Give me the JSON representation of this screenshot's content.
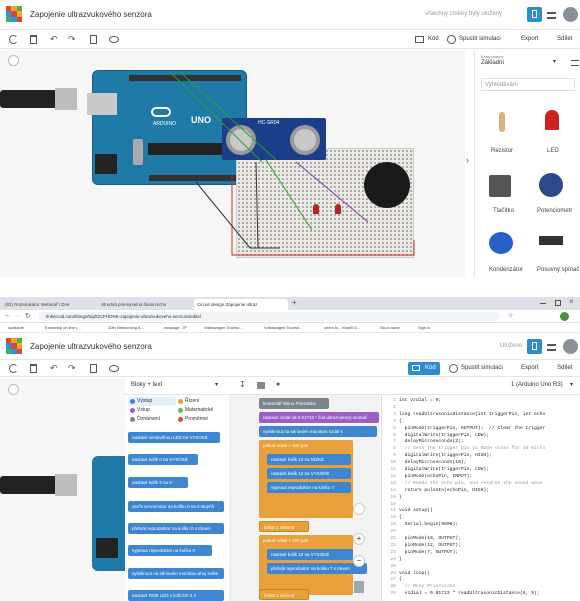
{
  "top": {
    "title": "Zapojenie ultrazvukového senzora",
    "saved": "Všechny změny byly uloženy",
    "toolbar": {
      "code": "Kód",
      "simulate": "Spustit simulaci",
      "export": "Export",
      "share": "Sdílet"
    },
    "panel": {
      "components_label": "Komponenty",
      "components_value": "Základní",
      "search_placeholder": "Vyhledávání",
      "items": [
        "Rezistor",
        "LED",
        "Tlačítko",
        "Potenciometr",
        "Kondenzátor",
        "Posuvný spínač"
      ]
    },
    "arduino": {
      "brand": "ARDUINO",
      "model": "UNO"
    },
    "sensor": {
      "label": "HC-SR04"
    }
  },
  "browser": {
    "tabs": [
      "(83) Rozetnikátor Webinář / Dne",
      "Stredná priemyselná škola techn",
      "Circuit design Zapojenie ultraz"
    ],
    "url": "tinkercad.com/things/5qZDCPHONK-zapojenie-ultrazvukoveho-senzora/editel",
    "bookmarks": [
      "Aplikácie",
      "Transmisji on line (...",
      "10th Networking A...",
      "edupage - IP",
      "Volkswagen Tourisn...",
      "Volkswagen Tourisn...",
      "chem.tu - Vlastit G...",
      "Slovo karie",
      "Sign in"
    ]
  },
  "bottom": {
    "title": "Zapojenie ultrazvukového senzora",
    "saved": "Uloženo",
    "toolbar": {
      "code": "Kód",
      "simulate": "Spustit simulaci",
      "export": "Export",
      "share": "Sdílet"
    },
    "blocks_mode": "Bloky + text",
    "device": "1 (Arduino Uno R3)",
    "categories": [
      "Výstup",
      "Řízení",
      "Vstup",
      "Matematické",
      "Oznámení",
      "Proměnné"
    ],
    "palette_blocks": [
      "nastavit vestavěnou LED na VYSOKÉ",
      "nastavit kolík 0 na VYSOKÉ",
      "nastavit kolík 3 na 0",
      "otočit servomotor na kolíku 0 na 0 stupňů",
      "přehrát reproduktor na kolíku 0 s tónem",
      "vypnout reproduktor na kolíku 0",
      "vytisknout na sériovém monitoru ahoj světe",
      "nastavit RGB LED v kolících 3 3"
    ],
    "workspace_blocks": {
      "comment": "komentář Meno Priezvisko",
      "b1": "nastavit vzdal na 0.01723 * číst ultrazvukový snímač",
      "b2": "vytisknout na sériovém monitoru vzdal s",
      "if1": "pokud vzdal > 100 pak",
      "b3": "nastavit kolík 10 na NÍZKÉ",
      "b4": "nastavit kolík 12 na VYSOKÉ",
      "b5": "vypnout reproduktor na kolíku 7",
      "wait1": "čekat 1 sekund",
      "if2": "pokud vzdal < 100 pak",
      "b6": "nastavit kolík 10 na VYSOKÉ",
      "b7": "přehrát reproduktor na kolíku 7 s tónem",
      "wait2": "čekat 1 sekund"
    },
    "code_lines": [
      "int vzdial = 0;",
      "",
      "long readUltrasonicDistance(int triggerPin, int echo",
      "{",
      "  pinMode(triggerPin, OUTPUT);  // Clear the trigger",
      "  digitalWrite(triggerPin, LOW);",
      "  delayMicroseconds(2);",
      "  // Sets the trigger pin to HIGH state for 10 micro",
      "  digitalWrite(triggerPin, HIGH);",
      "  delayMicroseconds(10);",
      "  digitalWrite(triggerPin, LOW);",
      "  pinMode(echoPin, INPUT);",
      "  // Reads the echo pin, and returns the sound wave",
      "  return pulseIn(echoPin, HIGH);",
      "}",
      "",
      "void setup()",
      "{",
      "  Serial.begin(9600);",
      "",
      "  pinMode(10, OUTPUT);",
      "  pinMode(12, OUTPUT);",
      "  pinMode(7, OUTPUT);",
      "}",
      "",
      "void loop()",
      "{",
      "  // Meno Priezvisko",
      "  vzdial = 0.01723 * readUltrasonicDistance(6, 5);"
    ],
    "line_numbers": [
      "1",
      "2",
      "3",
      "4",
      "5",
      "6",
      "7",
      "8",
      "9",
      "10",
      "11",
      "12",
      "13",
      "14",
      "15",
      "16",
      "17",
      "18",
      "19",
      "20",
      "21",
      "22",
      "23",
      "24",
      "25",
      "26",
      "27",
      "28",
      "29"
    ]
  }
}
